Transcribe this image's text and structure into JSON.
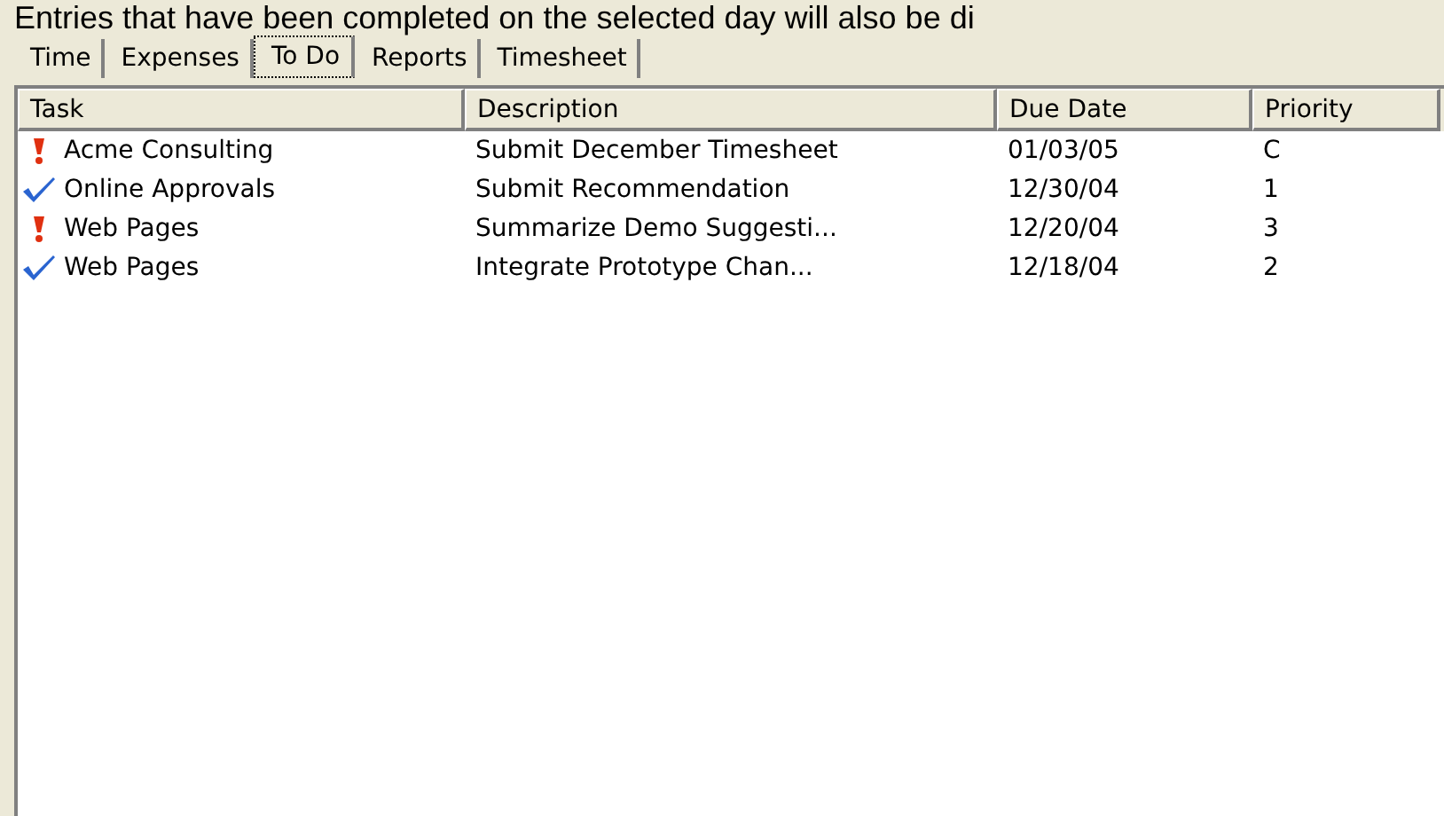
{
  "intro_text": "Entries that have been completed on the selected day will also be di",
  "tabs": [
    {
      "label": "Time",
      "selected": false
    },
    {
      "label": "Expenses",
      "selected": false
    },
    {
      "label": "To Do",
      "selected": true
    },
    {
      "label": "Reports",
      "selected": false
    },
    {
      "label": "Timesheet",
      "selected": false
    }
  ],
  "table": {
    "columns": [
      "Task",
      "Description",
      "Due Date",
      "Priority"
    ],
    "rows": [
      {
        "kind": "urgent",
        "task": "Acme Consulting",
        "description": "Submit December Timesheet",
        "due_date": "01/03/05",
        "priority": "C"
      },
      {
        "kind": "done",
        "task": "Online Approvals",
        "description": "Submit Recommendation",
        "due_date": "12/30/04",
        "priority": "1"
      },
      {
        "kind": "urgent",
        "task": "Web Pages",
        "description": "Summarize Demo Suggesti...",
        "due_date": "12/20/04",
        "priority": "3"
      },
      {
        "kind": "done",
        "task": "Web Pages",
        "description": "Integrate Prototype Chan...",
        "due_date": "12/18/04",
        "priority": "2"
      }
    ]
  }
}
